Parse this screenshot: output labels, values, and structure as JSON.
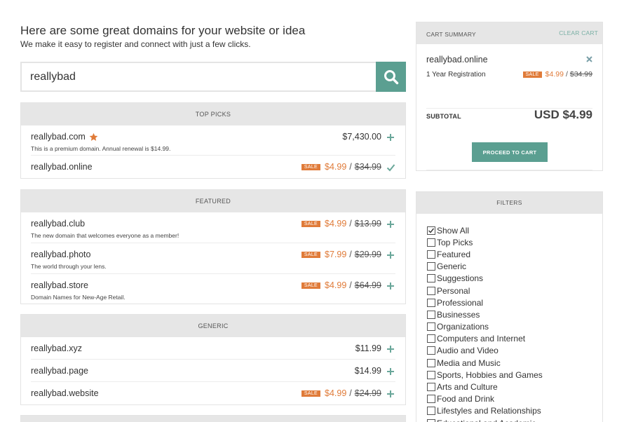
{
  "header": {
    "title": "Here are some great domains for your website or idea",
    "subtitle": "We make it easy to register and connect with just a few clicks."
  },
  "search": {
    "value": "reallybad"
  },
  "sections": {
    "top_picks": {
      "title": "TOP PICKS",
      "rows": [
        {
          "name": "reallybad.com",
          "desc": "This is a premium domain. Annual renewal is $14.99.",
          "price": "$7,430.00",
          "premium_icon": "star-icon",
          "action": "plus-icon"
        },
        {
          "name": "reallybad.online",
          "sale": "SALE",
          "price": "$4.99",
          "old_price": "$34.99",
          "action": "checkmark-icon"
        }
      ]
    },
    "featured": {
      "title": "FEATURED",
      "rows": [
        {
          "name": "reallybad.club",
          "desc": "The new domain that welcomes everyone as a member!",
          "sale": "SALE",
          "price": "$4.99",
          "old_price": "$13.99",
          "action": "plus-icon"
        },
        {
          "name": "reallybad.photo",
          "desc": "The world through your lens.",
          "sale": "SALE",
          "price": "$7.99",
          "old_price": "$29.99",
          "action": "plus-icon"
        },
        {
          "name": "reallybad.store",
          "desc": "Domain Names for New-Age Retail.",
          "sale": "SALE",
          "price": "$4.99",
          "old_price": "$64.99",
          "action": "plus-icon"
        }
      ]
    },
    "generic": {
      "title": "GENERIC",
      "rows": [
        {
          "name": "reallybad.xyz",
          "price": "$11.99",
          "action": "plus-icon"
        },
        {
          "name": "reallybad.page",
          "price": "$14.99",
          "action": "plus-icon"
        },
        {
          "name": "reallybad.website",
          "sale": "SALE",
          "price": "$4.99",
          "old_price": "$24.99",
          "action": "plus-icon"
        }
      ]
    }
  },
  "cart": {
    "title": "CART SUMMARY",
    "clear_label": "CLEAR CART",
    "item_name": "reallybad.online",
    "remove_icon": "close-icon",
    "registration": "1 Year Registration",
    "sale": "SALE",
    "price": "$4.99",
    "old_price": "$34.99",
    "subtotal_label": "SUBTOTAL",
    "subtotal_value": "USD $4.99",
    "proceed_label": "PROCEED TO CART"
  },
  "filters": {
    "title": "FILTERS",
    "items": [
      {
        "label": "Show All",
        "checked": true
      },
      {
        "label": "Top Picks",
        "checked": false
      },
      {
        "label": "Featured",
        "checked": false
      },
      {
        "label": "Generic",
        "checked": false
      },
      {
        "label": "Suggestions",
        "checked": false
      },
      {
        "label": "Personal",
        "checked": false
      },
      {
        "label": "Professional",
        "checked": false
      },
      {
        "label": "Businesses",
        "checked": false
      },
      {
        "label": "Organizations",
        "checked": false
      },
      {
        "label": "Computers and Internet",
        "checked": false
      },
      {
        "label": "Audio and Video",
        "checked": false
      },
      {
        "label": "Media and Music",
        "checked": false
      },
      {
        "label": "Sports, Hobbies and Games",
        "checked": false
      },
      {
        "label": "Arts and Culture",
        "checked": false
      },
      {
        "label": "Food and Drink",
        "checked": false
      },
      {
        "label": "Lifestyles and Relationships",
        "checked": false
      },
      {
        "label": "Educational and Academic",
        "checked": false
      }
    ]
  },
  "colors": {
    "accent": "#5b9f91",
    "sale": "#e07b39",
    "star": "#e07b39",
    "section_header_bg": "#e6e6e6",
    "action_icon": "#6aa79a"
  }
}
